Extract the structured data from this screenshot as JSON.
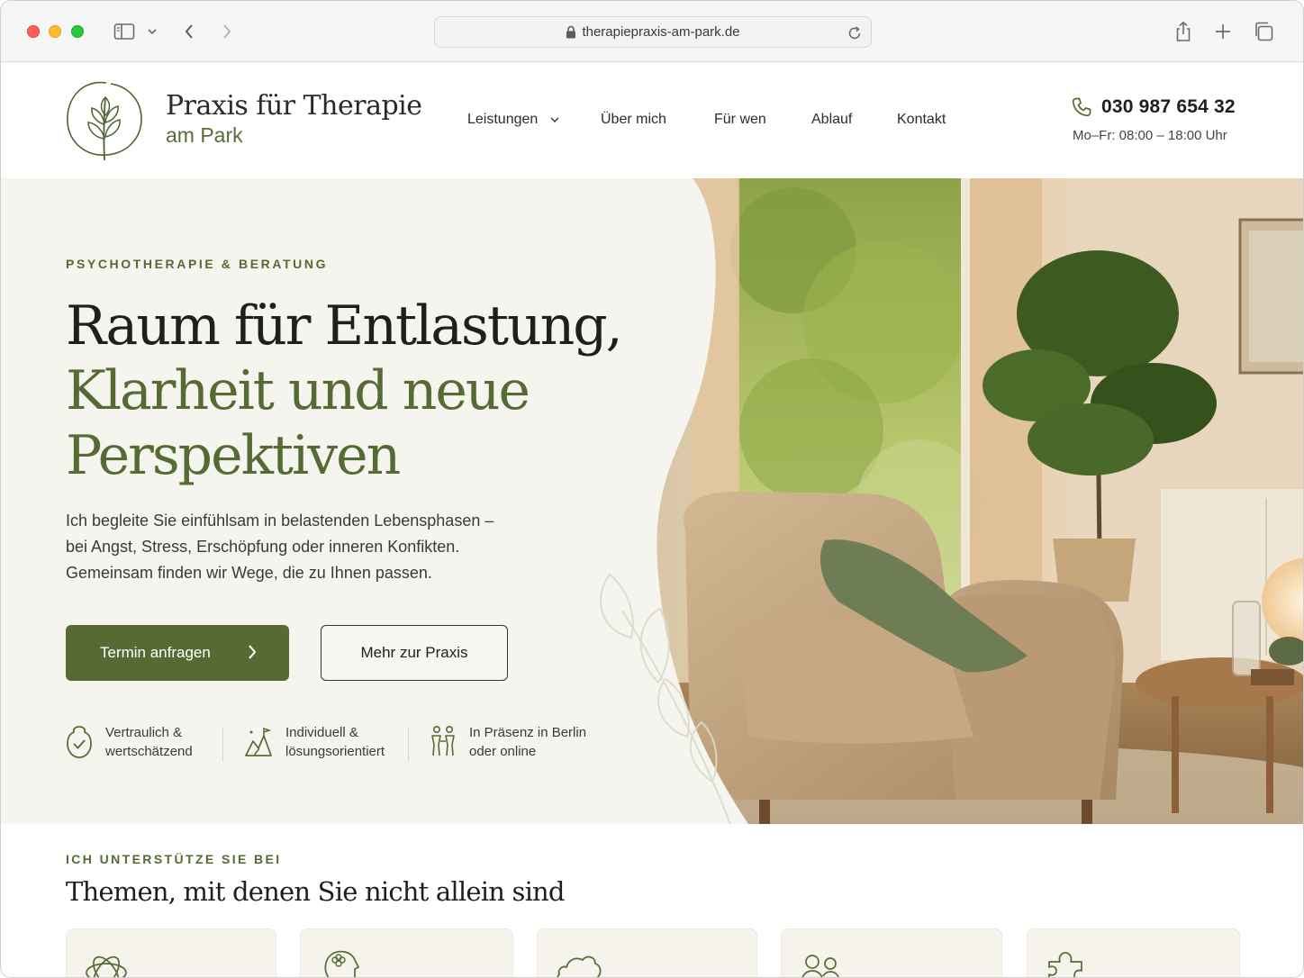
{
  "browser": {
    "url": "therapiepraxis-am-park.de"
  },
  "header": {
    "brand_line1": "Praxis für Therapie",
    "brand_line2": "am Park",
    "nav": [
      {
        "label": "Leistungen",
        "has_dropdown": true
      },
      {
        "label": "Über mich"
      },
      {
        "label": "Für wen"
      },
      {
        "label": "Ablauf"
      },
      {
        "label": "Kontakt"
      }
    ],
    "phone": "030 987 654 32",
    "hours": "Mo–Fr: 08:00 – 18:00 Uhr"
  },
  "hero": {
    "eyebrow": "PSYCHOTHERAPIE & BERATUNG",
    "headline_line1": "Raum für Entlastung,",
    "headline_line2": "Klarheit und neue",
    "headline_line3": "Perspektiven",
    "lead_line1": "Ich begleite Sie einfühlsam in belastenden Lebensphasen –",
    "lead_line2": "bei Angst, Stress, Erschöpfung oder inneren Konfikten.",
    "lead_line3": "Gemeinsam finden wir Wege, die zu Ihnen passen.",
    "primary_button": "Termin anfragen",
    "secondary_button": "Mehr zur Praxis",
    "features": [
      {
        "line1": "Vertraulich &",
        "line2": "wertschätzend",
        "icon": "shield-check-icon"
      },
      {
        "line1": "Individuell &",
        "line2": "lösungsorientiert",
        "icon": "path-mountain-icon"
      },
      {
        "line1": "In Präsenz in Berlin",
        "line2": "oder online",
        "icon": "people-meeting-icon"
      }
    ]
  },
  "section": {
    "eyebrow": "ICH UNTERSTÜTZE SIE BEI",
    "title": "Themen, mit denen Sie nicht allein sind",
    "cards": [
      {
        "icon": "atom-knot-icon"
      },
      {
        "icon": "head-flower-icon"
      },
      {
        "icon": "cloud-icon"
      },
      {
        "icon": "people-icon"
      },
      {
        "icon": "puzzle-icon"
      }
    ]
  },
  "colors": {
    "accent": "#566b33",
    "hero_bg": "#f5f4ee"
  }
}
